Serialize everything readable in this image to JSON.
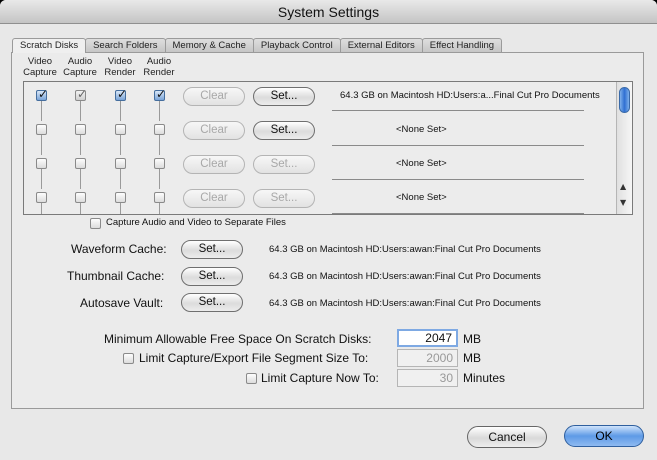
{
  "window": {
    "title": "System Settings"
  },
  "tabs": [
    "Scratch Disks",
    "Search Folders",
    "Memory & Cache",
    "Playback Control",
    "External Editors",
    "Effect Handling"
  ],
  "columns": {
    "video_capture": "Video\nCapture",
    "audio_capture": "Audio\nCapture",
    "video_render": "Video\nRender",
    "audio_render": "Audio\nRender"
  },
  "scratch_rows": [
    {
      "video_capture": true,
      "audio_capture": true,
      "video_render": true,
      "audio_render": true,
      "clear": "Clear",
      "set": "Set...",
      "path": "64.3 GB on  Macintosh HD:Users:a...Final Cut Pro Documents"
    },
    {
      "video_capture": false,
      "audio_capture": false,
      "video_render": false,
      "audio_render": false,
      "clear": "Clear",
      "set": "Set...",
      "path": "<None Set>"
    },
    {
      "video_capture": false,
      "audio_capture": false,
      "video_render": false,
      "audio_render": false,
      "clear": "Clear",
      "set": "Set...",
      "path": "<None Set>"
    },
    {
      "video_capture": false,
      "audio_capture": false,
      "video_render": false,
      "audio_render": false,
      "clear": "Clear",
      "set": "Set...",
      "path": "<None Set>"
    }
  ],
  "separate_files": {
    "label": "Capture Audio and Video to Separate Files",
    "checked": false
  },
  "caches": [
    {
      "label": "Waveform Cache:",
      "button": "Set...",
      "path": "64.3 GB on  Macintosh HD:Users:awan:Final Cut Pro Documents"
    },
    {
      "label": "Thumbnail Cache:",
      "button": "Set...",
      "path": "64.3 GB on  Macintosh HD:Users:awan:Final Cut Pro Documents"
    },
    {
      "label": "Autosave Vault:",
      "button": "Set...",
      "path": "64.3 GB on  Macintosh HD:Users:awan:Final Cut Pro Documents"
    }
  ],
  "min_free_space": {
    "label": "Minimum Allowable Free Space On Scratch Disks:",
    "value": "2047",
    "unit": "MB"
  },
  "limit_segment": {
    "label": "Limit Capture/Export File Segment Size To:",
    "value": "2000",
    "unit": "MB",
    "checked": false
  },
  "limit_capture": {
    "label": "Limit Capture Now To:",
    "value": "30",
    "unit": "Minutes",
    "checked": false
  },
  "footer": {
    "cancel": "Cancel",
    "ok": "OK"
  },
  "colors": {
    "accent": "#5e9ae6",
    "checkbox_on": "#7aa4d8"
  }
}
